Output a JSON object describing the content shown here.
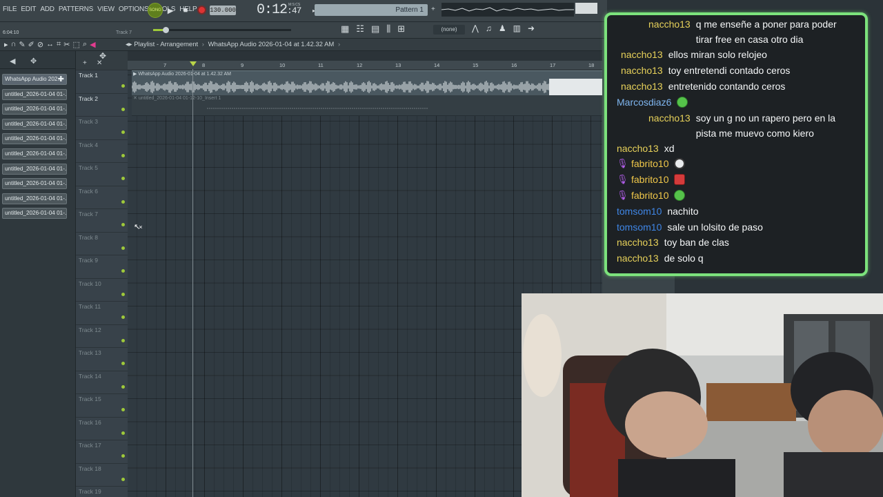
{
  "menu": [
    "FILE",
    "EDIT",
    "ADD",
    "PATTERNS",
    "VIEW",
    "OPTIONS",
    "TOOLS",
    "HELP"
  ],
  "transport": {
    "song_label": "SONG",
    "tempo": "130.000",
    "time_main": "0:12",
    "time_sub": "47",
    "time_unit": "M:S:CS",
    "pattern": "Pattern 1",
    "cpu_values": "8"
  },
  "row2": {
    "time_label": "6:04:10",
    "track_hint": "Track 7",
    "snap": "(none)"
  },
  "playlist": {
    "breadcrumb_root": "Playlist - Arrangement",
    "breadcrumb_item": "WhatsApp Audio 2026-01-04 at 1.42.32 AM",
    "ruler": [
      "7",
      "8",
      "9",
      "10",
      "11",
      "12",
      "13",
      "14",
      "15",
      "16",
      "17",
      "18"
    ],
    "clip1_title": "WhatsApp Audio 2026-01-04 at 1.42.32 AM",
    "clip2_title": "untitled_2026-01-04 01-12-10_Insert 1"
  },
  "browser": {
    "items": [
      "WhatsApp Audio 202...",
      "untitled_2026-01-04 01-...",
      "untitled_2026-01-04 01-...",
      "untitled_2026-01-04 01-...",
      "untitled_2026-01-04 01-...",
      "untitled_2026-01-04 01-...",
      "untitled_2026-01-04 01-...",
      "untitled_2026-01-04 01-...",
      "untitled_2026-01-04 01-...",
      "untitled_2026-01-04 01-..."
    ]
  },
  "tracks": [
    "Track 1",
    "Track 2",
    "Track 3",
    "Track 4",
    "Track 5",
    "Track 6",
    "Track 7",
    "Track 8",
    "Track 9",
    "Track 10",
    "Track 11",
    "Track 12",
    "Track 13",
    "Track 14",
    "Track 15",
    "Track 16",
    "Track 17",
    "Track 18",
    "Track 19"
  ],
  "chat": [
    {
      "user": "naccho13",
      "text": "q me enseñe a poner para poder tirar free en casa otro dia",
      "color": "naccho",
      "wrap": true,
      "indent": 2
    },
    {
      "user": "naccho13",
      "text": "ellos miran solo relojeo",
      "color": "naccho",
      "indent": 1
    },
    {
      "user": "naccho13",
      "text": "toy entretendi contado ceros",
      "color": "naccho",
      "indent": 1
    },
    {
      "user": "naccho13",
      "text": "entretenido contando ceros",
      "color": "naccho",
      "indent": 1
    },
    {
      "user": "Marcosdiaz6",
      "text": "",
      "color": "marcos",
      "emote": "green"
    },
    {
      "user": "naccho13",
      "text": "soy un g no un rapero pero en la pista me muevo como kiero",
      "color": "naccho",
      "wrap": true,
      "indent": 2
    },
    {
      "user": "naccho13",
      "text": "xd",
      "color": "naccho"
    },
    {
      "user": "fabrito10",
      "text": "",
      "color": "fabrito",
      "mic": true,
      "emote": "white"
    },
    {
      "user": "fabrito10",
      "text": "",
      "color": "fabrito",
      "mic": true,
      "emote": "red"
    },
    {
      "user": "fabrito10",
      "text": "",
      "color": "fabrito",
      "mic": true,
      "emote": "green"
    },
    {
      "user": "tomsom10",
      "text": "nachito",
      "color": "tomsom"
    },
    {
      "user": "tomsom10",
      "text": "sale un lolsito de paso",
      "color": "tomsom"
    },
    {
      "user": "naccho13",
      "text": "toy ban de clas",
      "color": "naccho"
    },
    {
      "user": "naccho13",
      "text": "de solo q",
      "color": "naccho"
    }
  ]
}
